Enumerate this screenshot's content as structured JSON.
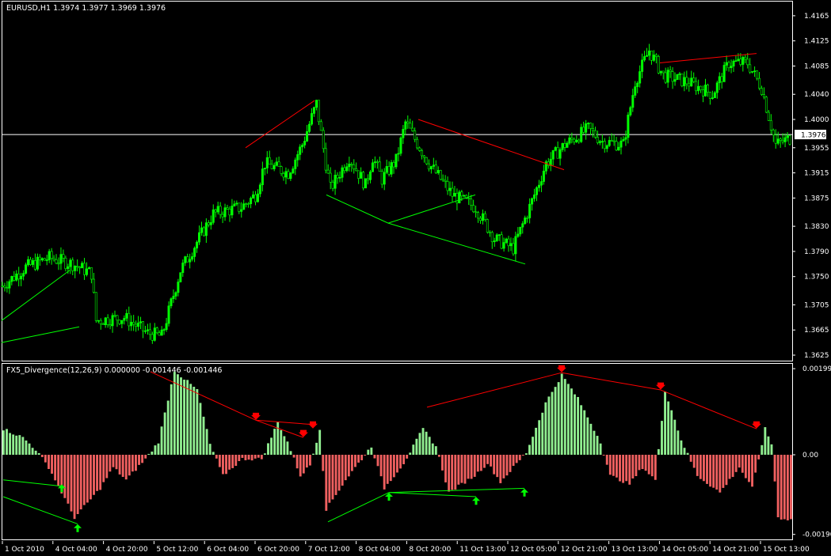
{
  "colors": {
    "background": "#000000",
    "bull": "#00ff00",
    "bear": "#000000",
    "wick": "#00ff00",
    "hist_positive": "#90ee90",
    "hist_negative": "#f06060",
    "bear_divergence_line": "#ff0000",
    "bull_divergence_line": "#00ff00",
    "bid_line": "#ffffff",
    "axis_text": "#ffffff",
    "bear_arrow": "#ff0000",
    "bull_arrow": "#00ff00"
  },
  "main_chart": {
    "title": "EURUSD,H1  1.3974 1.3977 1.3969 1.3976",
    "current_price": "1.3976",
    "current_price_value": 1.3976,
    "price_labels": [
      "1.4165",
      "1.4125",
      "1.4085",
      "1.4040",
      "1.4000",
      "1.3955",
      "1.3915",
      "1.3875",
      "1.3830",
      "1.3790",
      "1.3750",
      "1.3705",
      "1.3665",
      "1.3625"
    ]
  },
  "indicator": {
    "title": "FX5_Divergence(12,26,9) 0.000000 -0.001446 -0.001446",
    "labels": [
      "0.001993",
      "0.00",
      "-0.00190"
    ]
  },
  "time_labels": [
    "1 Oct 2010",
    "4 Oct 04:00",
    "4 Oct 20:00",
    "5 Oct 12:00",
    "6 Oct 04:00",
    "6 Oct 20:00",
    "7 Oct 12:00",
    "8 Oct 04:00",
    "8 Oct 20:00",
    "11 Oct 13:00",
    "12 Oct 05:00",
    "12 Oct 21:00",
    "13 Oct 13:00",
    "14 Oct 05:00",
    "14 Oct 21:00",
    "15 Oct 13:00"
  ],
  "chart_data": [
    {
      "type": "candlestick",
      "title": "EURUSD,H1  1.3974 1.3977 1.3969 1.3976",
      "ylim": [
        1.362,
        1.4185
      ],
      "bars": 214,
      "anchors": [
        [
          0,
          1.3735
        ],
        [
          10,
          1.3765
        ],
        [
          20,
          1.378
        ],
        [
          30,
          1.377
        ],
        [
          38,
          1.3755
        ],
        [
          40,
          1.368
        ],
        [
          52,
          1.3685
        ],
        [
          62,
          1.366
        ],
        [
          68,
          1.3655
        ],
        [
          76,
          1.376
        ],
        [
          90,
          1.385
        ],
        [
          102,
          1.386
        ],
        [
          108,
          1.388
        ],
        [
          112,
          1.393
        ],
        [
          122,
          1.3915
        ],
        [
          128,
          1.396
        ],
        [
          134,
          1.4025
        ],
        [
          138,
          1.393
        ],
        [
          140,
          1.389
        ],
        [
          148,
          1.394
        ],
        [
          155,
          1.3895
        ],
        [
          158,
          1.394
        ],
        [
          162,
          1.3905
        ],
        [
          168,
          1.3935
        ],
        [
          172,
          1.3995
        ],
        [
          182,
          1.393
        ],
        [
          192,
          1.388
        ],
        [
          202,
          1.386
        ],
        [
          210,
          1.381
        ],
        [
          218,
          1.3795
        ],
        [
          226,
          1.387
        ],
        [
          232,
          1.393
        ],
        [
          240,
          1.396
        ],
        [
          250,
          1.3985
        ],
        [
          256,
          1.3965
        ],
        [
          265,
          1.396
        ],
        [
          270,
          1.406
        ],
        [
          276,
          1.411
        ],
        [
          282,
          1.407
        ],
        [
          292,
          1.406
        ],
        [
          298,
          1.405
        ],
        [
          303,
          1.404
        ],
        [
          310,
          1.409
        ],
        [
          318,
          1.409
        ],
        [
          324,
          1.405
        ],
        [
          330,
          1.396
        ],
        [
          336,
          1.397
        ]
      ],
      "divergence_lines": [
        {
          "kind": "bear",
          "points": [
            [
              310,
              1.3955
            ],
            [
              397,
              1.403
            ]
          ]
        },
        {
          "kind": "bear",
          "points": [
            [
              528,
              1.4
            ],
            [
              712,
              1.392
            ]
          ]
        },
        {
          "kind": "bear",
          "points": [
            [
              833,
              1.409
            ],
            [
              955,
              1.4105
            ]
          ]
        },
        {
          "kind": "bull",
          "points": [
            [
              2,
              1.368
            ],
            [
              88,
              1.376
            ]
          ]
        },
        {
          "kind": "bull",
          "points": [
            [
              2,
              1.3645
            ],
            [
              100,
              1.367
            ]
          ]
        },
        {
          "kind": "bull",
          "points": [
            [
              412,
              1.388
            ],
            [
              490,
              1.3835
            ]
          ]
        },
        {
          "kind": "bull",
          "points": [
            [
              490,
              1.3835
            ],
            [
              663,
              1.377
            ]
          ]
        },
        {
          "kind": "bull",
          "points": [
            [
              490,
              1.3835
            ],
            [
              600,
              1.388
            ]
          ]
        }
      ]
    },
    {
      "type": "histogram",
      "title": "FX5_Divergence(12,26,9) 0.000000 -0.001446 -0.001446",
      "ylim": [
        -0.002,
        0.00205
      ],
      "zero": 0.0,
      "anchors": [
        [
          0,
          0.0006
        ],
        [
          6,
          0.0004
        ],
        [
          10,
          0.00012
        ],
        [
          14,
          -0.0003
        ],
        [
          22,
          -0.0015
        ],
        [
          30,
          -0.0008
        ],
        [
          34,
          -0.0003
        ],
        [
          38,
          -0.0006
        ],
        [
          44,
          -0.0001
        ],
        [
          48,
          0.0003
        ],
        [
          53,
          0.00195
        ],
        [
          60,
          0.0015
        ],
        [
          64,
          0.00025
        ],
        [
          68,
          -0.0005
        ],
        [
          74,
          -0.0001
        ],
        [
          80,
          -0.0001
        ],
        [
          85,
          0.00075
        ],
        [
          88,
          0.0003
        ],
        [
          92,
          -0.0005
        ],
        [
          95,
          -0.00025
        ],
        [
          98,
          0.0006
        ],
        [
          100,
          -0.0013
        ],
        [
          106,
          -0.0006
        ],
        [
          110,
          -0.0002
        ],
        [
          114,
          0.0002
        ],
        [
          118,
          -0.0008
        ],
        [
          124,
          -0.0002
        ],
        [
          130,
          0.0006
        ],
        [
          134,
          0.0002
        ],
        [
          138,
          -0.0009
        ],
        [
          146,
          -0.0005
        ],
        [
          150,
          -0.0002
        ],
        [
          154,
          -0.00065
        ],
        [
          158,
          -0.0003
        ],
        [
          162,
          5e-05
        ],
        [
          168,
          0.0012
        ],
        [
          173,
          0.00185
        ],
        [
          178,
          0.0013
        ],
        [
          185,
          0.0003
        ],
        [
          188,
          -0.0005
        ],
        [
          194,
          -0.0007
        ],
        [
          198,
          -0.0003
        ],
        [
          202,
          -0.0006
        ],
        [
          205,
          0.0015
        ],
        [
          210,
          0.00035
        ],
        [
          215,
          -0.0005
        ],
        [
          222,
          -0.0009
        ],
        [
          228,
          -0.0003
        ],
        [
          232,
          -0.0008
        ],
        [
          236,
          0.0006
        ],
        [
          238,
          0.00025
        ],
        [
          240,
          -0.0015
        ],
        [
          244,
          -0.00155
        ]
      ],
      "bear_arrows": [
        [
          323,
          0.0009
        ],
        [
          383,
          0.0005
        ],
        [
          395,
          0.0007
        ],
        [
          709,
          0.002
        ],
        [
          834,
          0.0016
        ],
        [
          955,
          0.0007
        ]
      ],
      "bull_arrows": [
        [
          78,
          -0.0008
        ],
        [
          98,
          -0.00175
        ],
        [
          491,
          -0.001
        ],
        [
          601,
          -0.0011
        ],
        [
          662,
          -0.0009
        ]
      ],
      "divergence_lines": [
        {
          "kind": "bear",
          "points": [
            [
              190,
              0.00192
            ],
            [
              323,
              0.0008
            ]
          ]
        },
        {
          "kind": "bear",
          "points": [
            [
              323,
              0.0008
            ],
            [
              395,
              0.0007
            ]
          ]
        },
        {
          "kind": "bear",
          "points": [
            [
              323,
              0.0008
            ],
            [
              383,
              0.0004
            ]
          ]
        },
        {
          "kind": "bear",
          "points": [
            [
              539,
              0.0011
            ],
            [
              709,
              0.0019
            ]
          ]
        },
        {
          "kind": "bear",
          "points": [
            [
              709,
              0.0019
            ],
            [
              834,
              0.0015
            ]
          ]
        },
        {
          "kind": "bear",
          "points": [
            [
              834,
              0.0015
            ],
            [
              955,
              0.0006
            ]
          ]
        },
        {
          "kind": "bull",
          "points": [
            [
              4,
              -0.0006
            ],
            [
              78,
              -0.00075
            ]
          ]
        },
        {
          "kind": "bull",
          "points": [
            [
              4,
              -0.001
            ],
            [
              98,
              -0.00165
            ]
          ]
        },
        {
          "kind": "bull",
          "points": [
            [
              414,
              -0.0016
            ],
            [
              491,
              -0.0009
            ]
          ]
        },
        {
          "kind": "bull",
          "points": [
            [
              491,
              -0.0009
            ],
            [
              601,
              -0.001
            ]
          ]
        },
        {
          "kind": "bull",
          "points": [
            [
              491,
              -0.0009
            ],
            [
              662,
              -0.0008
            ]
          ]
        }
      ]
    }
  ]
}
